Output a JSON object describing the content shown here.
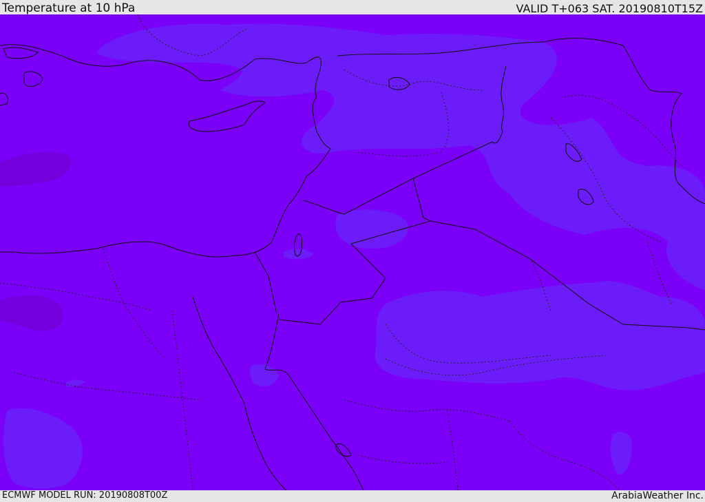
{
  "header": {
    "title": "Temperature at 10 hPa",
    "valid_time": "VALID T+063 SAT. 20190810T15Z"
  },
  "footer": {
    "model_run": "ECMWF MODEL RUN: 20190808T00Z",
    "credit": "ArabiaWeather Inc."
  },
  "map": {
    "variable": "temperature",
    "level": "10 hPa",
    "colors": {
      "base_field": "#7a00f8",
      "cool_field": "#6c1cf8",
      "warm_field": "#7300dc",
      "coastline": "#111111",
      "borders": "#222222"
    }
  }
}
